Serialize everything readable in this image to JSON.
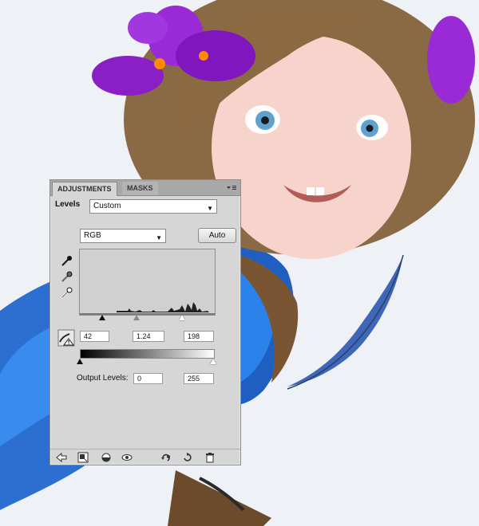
{
  "panel": {
    "tabs": [
      {
        "label": "ADJUSTMENTS",
        "active": true
      },
      {
        "label": "MASKS",
        "active": false
      }
    ],
    "menu_icon": "panel-menu-icon",
    "levels_label": "Levels",
    "preset": "Custom",
    "channel": "RGB",
    "auto_label": "Auto",
    "input_levels": {
      "shadow": "42",
      "midtone": "1.24",
      "highlight": "198"
    },
    "output_label": "Output Levels:",
    "output_levels": {
      "min": "0",
      "max": "255"
    },
    "icons": [
      "eyedropper-black-icon",
      "eyedropper-gray-icon",
      "eyedropper-white-icon",
      "clipping-warning-icon"
    ],
    "bottom_icons": [
      "back-arrow-icon",
      "clip-to-layer-icon",
      "layer-visibility-mask-icon",
      "eye-icon",
      "previous-state-icon",
      "reset-icon",
      "trash-icon"
    ]
  },
  "colors": {
    "panel_bg": "#d6d6d6",
    "tab_bar": "#a8a8a8",
    "canvas_bg": "#eef1f6",
    "flower": "#8b1fc6",
    "hair": "#8a6a45",
    "feather_blue": "#2d6fd1"
  }
}
